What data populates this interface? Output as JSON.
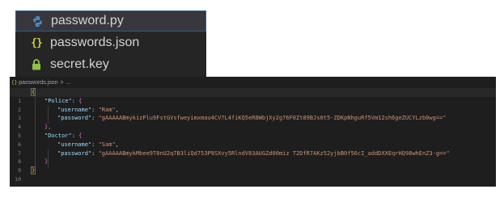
{
  "explorer": {
    "files": [
      {
        "name": "password.py",
        "icon": "python-icon",
        "selected": true
      },
      {
        "name": "passwords.json",
        "icon": "json-braces-icon",
        "icon_glyph": "{}",
        "selected": false
      },
      {
        "name": "secret.key",
        "icon": "lock-icon",
        "selected": false
      }
    ]
  },
  "editor": {
    "breadcrumb": {
      "icon_glyph": "{}",
      "file": "passwords.json",
      "separator": ">",
      "ellipsis": "..."
    },
    "line_numbers": [
      "1",
      "2",
      "3",
      "4",
      "5",
      "6",
      "7",
      "8",
      "9",
      "10"
    ],
    "code": {
      "open_brace": "{",
      "police_key": "\"Police\"",
      "doctor_key": "\"Doctor\"",
      "username_key": "\"username\"",
      "password_key": "\"password\"",
      "police_username": "\"Ram\"",
      "police_password": "\"gAAAAABmykizPlu9FstGVsfweyimxmau4CV7L4fiKQ5eR8WbjXy2g76F0Zt89BJs0t5-ZDKpNhguRf5Vm12sh6geZUCYLzb0wg==\"",
      "doctor_username": "\"Sam\"",
      "doctor_password": "\"gAAAAABmykMbee9T0nU2q7B3liQd753P9SXvy5RlndV83AUGZd00miz T2DfR7AKz52yjbB0f56cI_addDXXEqrHQ98whEnZ3-g==\"",
      "close_brace": "}",
      "close_brace_comma": "},"
    }
  },
  "colors": {
    "explorer_bg": "#252526",
    "editor_bg": "#1e1e1e",
    "key": "#9cdcfe",
    "string": "#ce9178",
    "brace": "#ffd700",
    "brace_nested": "#da70d6"
  }
}
